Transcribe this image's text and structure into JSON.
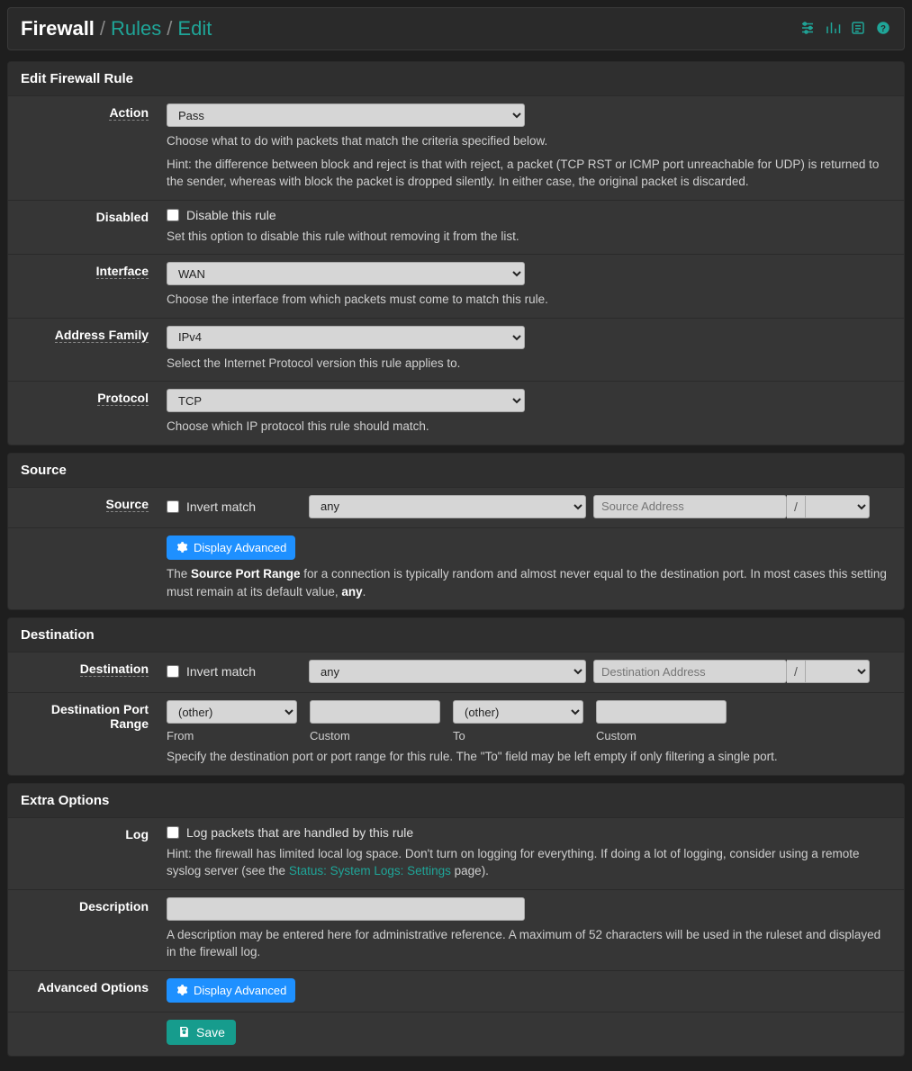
{
  "breadcrumb": {
    "firewall": "Firewall",
    "rules": "Rules",
    "edit": "Edit"
  },
  "panels": {
    "editRule": {
      "title": "Edit Firewall Rule",
      "action": {
        "label": "Action",
        "value": "Pass",
        "help1": "Choose what to do with packets that match the criteria specified below.",
        "help2": "Hint: the difference between block and reject is that with reject, a packet (TCP RST or ICMP port unreachable for UDP) is returned to the sender, whereas with block the packet is dropped silently. In either case, the original packet is discarded."
      },
      "disabled": {
        "label": "Disabled",
        "chk": "Disable this rule",
        "help": "Set this option to disable this rule without removing it from the list."
      },
      "interface": {
        "label": "Interface",
        "value": "WAN",
        "help": "Choose the interface from which packets must come to match this rule."
      },
      "addrfam": {
        "label": "Address Family",
        "value": "IPv4",
        "help": "Select the Internet Protocol version this rule applies to."
      },
      "protocol": {
        "label": "Protocol",
        "value": "TCP",
        "help": "Choose which IP protocol this rule should match."
      }
    },
    "source": {
      "title": "Source",
      "label": "Source",
      "invert": "Invert match",
      "type": "any",
      "addr_placeholder": "Source Address",
      "slash": "/",
      "adv_btn": "Display Advanced",
      "help_pre": "The ",
      "help_b": "Source Port Range",
      "help_mid": " for a connection is typically random and almost never equal to the destination port. In most cases this setting must remain at its default value, ",
      "help_b2": "any",
      "help_post": "."
    },
    "dest": {
      "title": "Destination",
      "label": "Destination",
      "invert": "Invert match",
      "type": "any",
      "addr_placeholder": "Destination Address",
      "slash": "/",
      "port": {
        "label": "Destination Port Range",
        "from_sel": "(other)",
        "from_lbl": "From",
        "from_custom_lbl": "Custom",
        "to_sel": "(other)",
        "to_lbl": "To",
        "to_custom_lbl": "Custom",
        "help": "Specify the destination port or port range for this rule. The \"To\" field may be left empty if only filtering a single port."
      }
    },
    "extra": {
      "title": "Extra Options",
      "log": {
        "label": "Log",
        "chk": "Log packets that are handled by this rule",
        "help1": "Hint: the firewall has limited local log space. Don't turn on logging for everything. If doing a lot of logging, consider using a remote syslog server (see the ",
        "link": "Status: System Logs: Settings",
        "help2": " page)."
      },
      "desc": {
        "label": "Description",
        "value": "",
        "help": "A description may be entered here for administrative reference. A maximum of 52 characters will be used in the ruleset and displayed in the firewall log."
      },
      "adv": {
        "label": "Advanced Options",
        "btn": "Display Advanced"
      }
    },
    "save": "Save"
  }
}
